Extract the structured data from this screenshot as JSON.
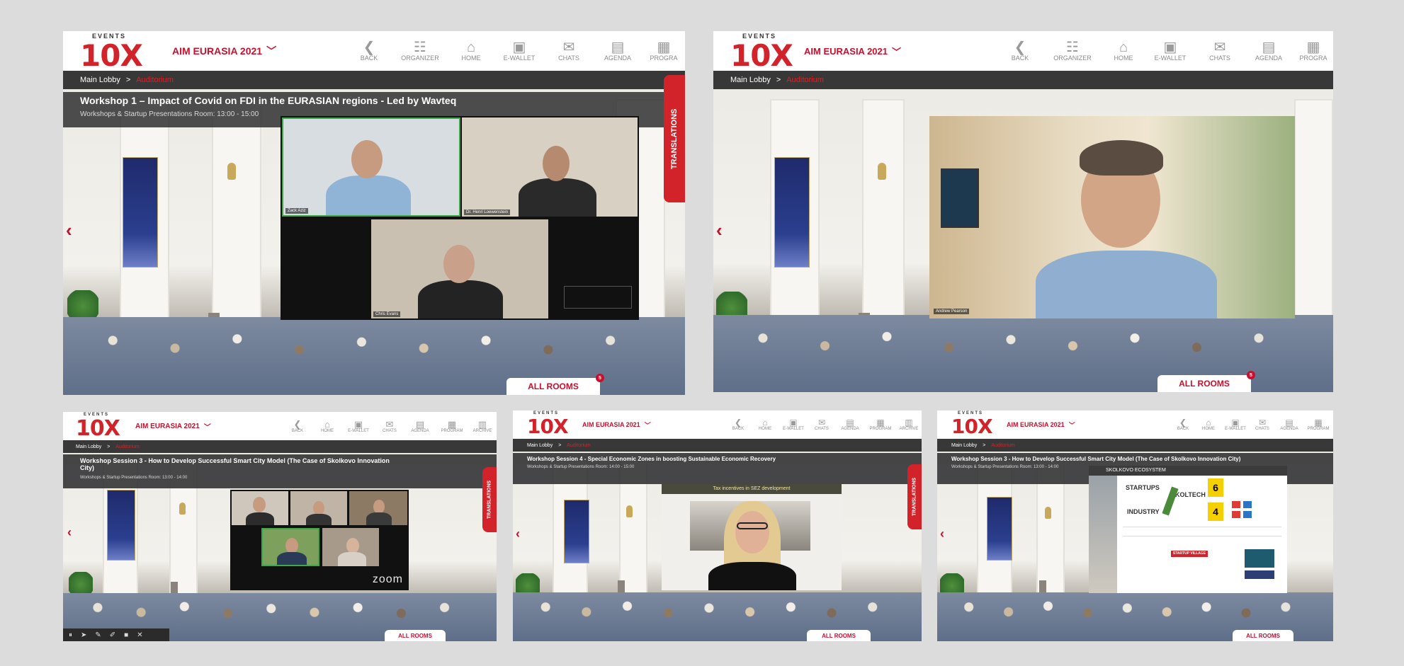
{
  "header": {
    "logo_top": "EVENTS",
    "logo_main": "10X",
    "event_title": "AIM EURASIA 2021",
    "chevron_icon": "chevron-down-icon",
    "nav": [
      {
        "label": "BACK",
        "icon": "back-arrow-icon",
        "glyph": "❮"
      },
      {
        "label": "ORGANIZER",
        "icon": "organizer-icon",
        "glyph": "☷"
      },
      {
        "label": "HOME",
        "icon": "home-icon",
        "glyph": "⌂"
      },
      {
        "label": "E-WALLET",
        "icon": "wallet-icon",
        "glyph": "▣"
      },
      {
        "label": "CHATS",
        "icon": "chat-icon",
        "glyph": "✉"
      },
      {
        "label": "AGENDA",
        "icon": "agenda-icon",
        "glyph": "▤"
      },
      {
        "label": "PROGRA",
        "icon": "program-icon",
        "glyph": "▦"
      }
    ],
    "nav_small": [
      {
        "label": "BACK",
        "icon": "back-arrow-icon",
        "glyph": "❮"
      },
      {
        "label": "HOME",
        "icon": "home-icon",
        "glyph": "⌂"
      },
      {
        "label": "E-WALLET",
        "icon": "wallet-icon",
        "glyph": "▣"
      },
      {
        "label": "CHATS",
        "icon": "chat-icon",
        "glyph": "✉"
      },
      {
        "label": "AGENDA",
        "icon": "agenda-icon",
        "glyph": "▤"
      },
      {
        "label": "PROGRAM",
        "icon": "program-icon",
        "glyph": "▦"
      },
      {
        "label": "ARCHIVE",
        "icon": "archive-icon",
        "glyph": "▥"
      }
    ]
  },
  "breadcrumb": {
    "root": "Main Lobby",
    "sep": ">",
    "current": "Auditorium"
  },
  "translations_label": "TRANSLATIONS",
  "all_rooms_label": "ALL ROOMS",
  "all_rooms_badge": "5",
  "shots": {
    "s1": {
      "title": "Workshop 1 – Impact of Covid on FDI in the EURASIAN regions - Led by Wavteq",
      "subtitle": "Workshops & Startup Presentations Room: 13:00 - 15:00",
      "participants": [
        "Zack Aziz",
        "Dr. Henri Loewenstein",
        "Chris Evans"
      ]
    },
    "s2": {
      "participant": "Andrew Pearson"
    },
    "s3": {
      "title": "Workshop Session 3 - How to Develop Successful Smart City Model (The Case of Skolkovo Innovation City)",
      "subtitle": "Workshops & Startup Presentations Room: 13:00 - 14:00",
      "zoom": "zoom"
    },
    "s4": {
      "title": "Workshop Session 4 - Special Economic Zones in boosting Sustainable Economic Recovery",
      "subtitle": "Workshops & Startup Presentations Room: 14:00 - 15:00",
      "overlay": "Tax incentives in SEZ development"
    },
    "s5": {
      "title": "Workshop Session 3 - How to Develop Successful Smart City Model (The Case of Skolkovo Innovation City)",
      "subtitle": "Workshops & Startup Presentations Room: 13:00 - 14:00",
      "slide_header": "SKOLKOVO ECOSYSTEM",
      "slide_words": [
        "STARTUPS",
        "SKOLTECH",
        "INDUSTRY"
      ],
      "slide_numbers": [
        "6",
        "4"
      ],
      "slide_button": "STARTUP VILLAGE"
    }
  },
  "colors": {
    "brand": "#d3232a",
    "bar": "#28282a",
    "bg": "#dcdcdc"
  }
}
